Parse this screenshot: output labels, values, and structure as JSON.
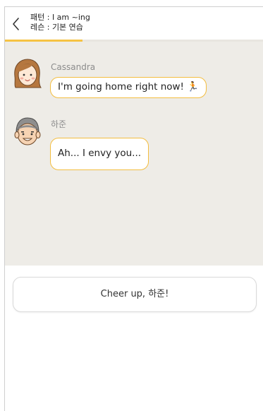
{
  "header": {
    "pattern_text": "패턴 : I am ~ing",
    "lesson_text": "레슨 : 기본 연습"
  },
  "progress": {
    "fraction": 0.3,
    "color": "#f6c344"
  },
  "messages": [
    {
      "speaker": "Cassandra",
      "text": "I'm going home right now! 🏃",
      "avatar_icon": "woman-avatar-icon"
    },
    {
      "speaker": "하준",
      "text": "Ah... I envy you...",
      "avatar_icon": "man-avatar-icon"
    }
  ],
  "answer": {
    "label": "Cheer up, 하준!"
  },
  "colors": {
    "bubble_border": "#f3bd3f",
    "chat_background": "#eeece7"
  }
}
